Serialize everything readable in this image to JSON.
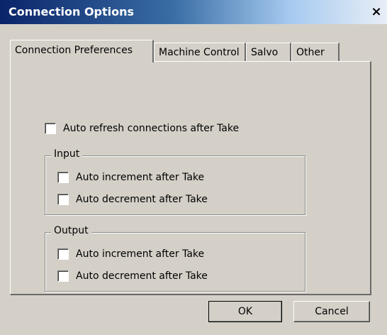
{
  "window": {
    "title": "Connection Options",
    "close_glyph": "×",
    "close_icon": "close-icon"
  },
  "tabs": [
    {
      "label": "Connection Preferences",
      "active": true
    },
    {
      "label": "Machine Control",
      "active": false
    },
    {
      "label": "Salvo",
      "active": false
    },
    {
      "label": "Other",
      "active": false
    }
  ],
  "panel": {
    "auto_refresh": {
      "label": "Auto refresh connections after Take",
      "checked": false
    },
    "input_group": {
      "legend": "Input",
      "auto_increment": {
        "label": "Auto increment after Take",
        "checked": false
      },
      "auto_decrement": {
        "label": "Auto decrement after Take",
        "checked": false
      }
    },
    "output_group": {
      "legend": "Output",
      "auto_increment": {
        "label": "Auto increment after Take",
        "checked": false
      },
      "auto_decrement": {
        "label": "Auto decrement after Take",
        "checked": false
      }
    }
  },
  "buttons": {
    "ok": "OK",
    "cancel": "Cancel"
  },
  "colors": {
    "face": "#d4d0c8",
    "titlebar_start": "#0a246a",
    "titlebar_end": "#a6caf0"
  }
}
